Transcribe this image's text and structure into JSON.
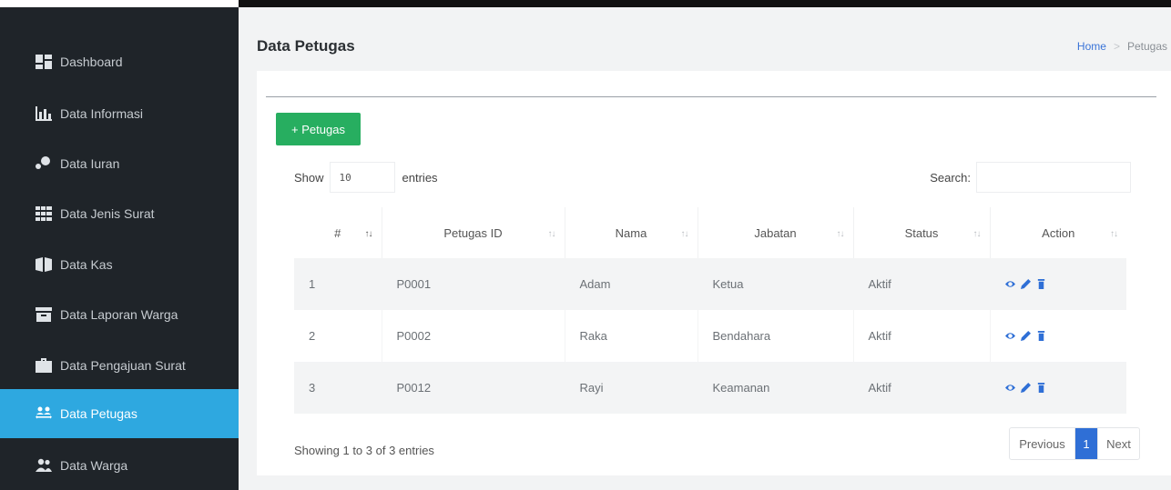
{
  "sidebar": {
    "items": [
      {
        "label": "Dashboard",
        "icon": "dashboard-icon"
      },
      {
        "label": "Data Informasi",
        "icon": "bar-chart-icon"
      },
      {
        "label": "Data Iuran",
        "icon": "donate-icon"
      },
      {
        "label": "Data Jenis Surat",
        "icon": "grid-icon"
      },
      {
        "label": "Data Kas",
        "icon": "book-icon"
      },
      {
        "label": "Data Laporan Warga",
        "icon": "archive-icon"
      },
      {
        "label": "Data Pengajuan Surat",
        "icon": "briefcase-icon"
      },
      {
        "label": "Data Petugas",
        "icon": "people-arrows-icon",
        "active": true
      },
      {
        "label": "Data Warga",
        "icon": "users-icon"
      }
    ]
  },
  "header": {
    "title": "Data Petugas",
    "breadcrumb": {
      "home": "Home",
      "separator": ">",
      "current": "Petugas"
    }
  },
  "main": {
    "add_button": "+ Petugas",
    "show_label": "Show",
    "entries_value": "10",
    "entries_label": "entries",
    "search_label": "Search:",
    "search_value": "",
    "columns": [
      "#",
      "Petugas ID",
      "Nama",
      "Jabatan",
      "Status",
      "Action"
    ],
    "rows": [
      {
        "no": "1",
        "id": "P0001",
        "nama": "Adam",
        "jabatan": "Ketua",
        "status": "Aktif"
      },
      {
        "no": "2",
        "id": "P0002",
        "nama": "Raka",
        "jabatan": "Bendahara",
        "status": "Aktif"
      },
      {
        "no": "3",
        "id": "P0012",
        "nama": "Rayi",
        "jabatan": "Keamanan",
        "status": "Aktif"
      }
    ],
    "info": "Showing 1 to 3 of 3 entries",
    "pagination": {
      "previous": "Previous",
      "current": "1",
      "next": "Next"
    }
  },
  "colors": {
    "sidebar_bg": "#1f2429",
    "active": "#2ea8e0",
    "add_button": "#27ae60",
    "link": "#2f6fd6"
  }
}
